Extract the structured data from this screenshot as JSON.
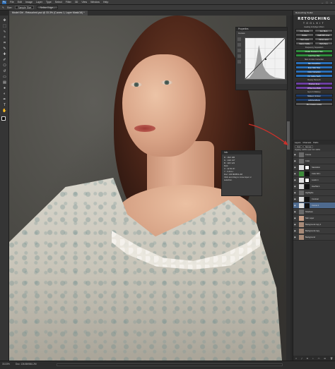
{
  "menubar": {
    "app_badge": "Ps",
    "items": [
      "File",
      "Edit",
      "Image",
      "Layer",
      "Type",
      "Select",
      "Filter",
      "3D",
      "View",
      "Window",
      "Help"
    ]
  },
  "options_bar": {
    "size_label": "Size:",
    "size_value": "Sample Size",
    "refine_button": "Refine Edge..."
  },
  "document": {
    "tab_title": "Model Girl - Retouched.psd @ 33.3% (Curves 1, Layer Mask/16) *"
  },
  "properties": {
    "title": "Properties",
    "subtitle": "Curves",
    "preset_label": "Preset: Custom"
  },
  "info_panel": {
    "title": "Info",
    "rows": [
      "R : 184/ 186",
      "G : 144/ 147",
      "B : 120/ 123",
      "8-bit",
      "X : 12.52   W :",
      "Y : 3.44    H :"
    ],
    "doc_line": "Doc: 136.8M/861.2M",
    "hint": "Click and drag to move layer or selection."
  },
  "retouch": {
    "tab": "Retouching Toolkit",
    "logo_main": "RETOUCHING",
    "logo_sub": "TOOLKIT",
    "sections": {
      "a": "Healing & Dodge & Burn",
      "b": "Frequency Separation",
      "c": "Skin & Color Correction",
      "d": "Beauty Retouch",
      "e": "Eyes & Makeup"
    },
    "row1": [
      "Cur. Dodge",
      "Cur. Burn"
    ],
    "row2": [
      "Dodge",
      "D&B 50% Gray"
    ],
    "row3": [
      "Heal. Layer",
      "Clone Layer"
    ],
    "row4": [
      "Stamp Visible",
      "High Pass"
    ],
    "buttons_green": [
      "Create Frequency Sep.",
      "Low Freq. Blur"
    ],
    "buttons_blue": [
      "Skin Smoothing",
      "Even Skin Tone",
      "Color Correction",
      "Fix Yellow Teeth"
    ],
    "buttons_purple": [
      "Sharpen Eyes",
      "Whiten Eye Balls"
    ],
    "buttons_dark": [
      "Makeup Contour",
      "Lighting Effects"
    ],
    "extra_gray": [
      "Run Custom Action"
    ]
  },
  "layers": {
    "tabs": [
      "Layers",
      "Channels",
      "Paths"
    ],
    "kind_label": "Kind",
    "blend_label": "Normal",
    "opacity_label": "Opacity: 100%",
    "lock_label": "Lock:",
    "fill_label": "Fill: 100%",
    "rows": [
      {
        "name": "Curves"
      },
      {
        "name": "Color"
      },
      {
        "name": "Saturation"
      },
      {
        "name": "Color Fill 1"
      },
      {
        "name": "Levels 1"
      },
      {
        "name": "Hue/Sat 1"
      },
      {
        "name": "Highlights"
      },
      {
        "name": "Contrast"
      },
      {
        "name": "Curves 1"
      },
      {
        "name": "Shadows"
      },
      {
        "name": "Skin Layer"
      },
      {
        "name": "Background copy 2"
      },
      {
        "name": "Background copy"
      },
      {
        "name": "Background"
      }
    ],
    "footer_icons": [
      "link-icon",
      "fx-icon",
      "mask-icon",
      "adjustment-icon",
      "folder-icon",
      "new-layer-icon",
      "trash-icon"
    ]
  },
  "status": {
    "zoom": "33.33%",
    "doc": "Doc: 136.8M/861.2M"
  },
  "colors": {
    "arrow": "#c8312b",
    "green_btn": "#2f8c3d",
    "blue_btn": "#2a6fb8",
    "purple_btn": "#6c3fa0",
    "dark_btn": "#1f3d6b",
    "gray_btn": "#5a5a5a",
    "selected_layer": "#4e6a8e"
  }
}
